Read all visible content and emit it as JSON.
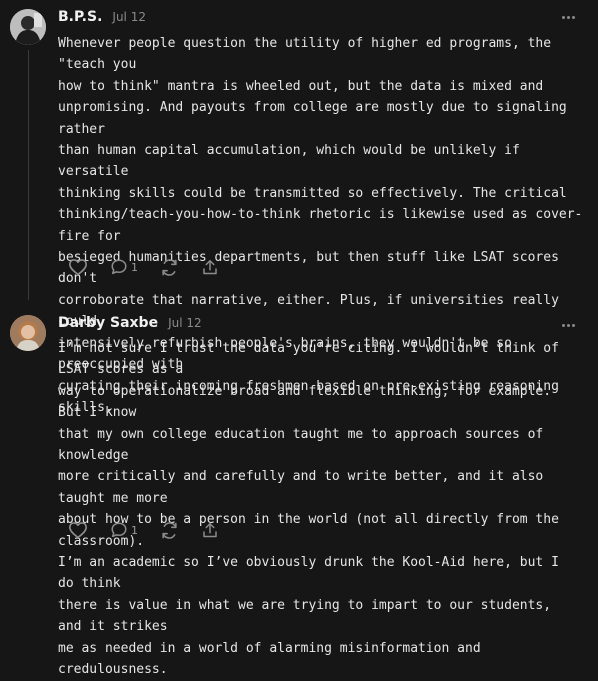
{
  "comments": [
    {
      "author": "B.P.S.",
      "date": "Jul 12",
      "lines": [
        "Whenever people question the utility of higher ed programs, the \"teach you",
        "how to think\" mantra is wheeled out, but the data is mixed and",
        "unpromising. And payouts from college are mostly due to signaling rather",
        "than human capital accumulation, which would be unlikely if versatile",
        "thinking skills could be transmitted so effectively. The critical",
        "thinking/teach-you-how-to-think rhetoric is likewise used as cover-fire for",
        "besieged humanities departments, but then stuff like LSAT scores don't",
        "corroborate that narrative, either. Plus, if universities really could",
        "intensively refurbish people's brains, they wouldn't be so preoccupied with",
        "curating their incoming freshmen based on pre-existing reasoning skills."
      ],
      "reply_count": "1"
    },
    {
      "author": "Darby Saxbe",
      "date": "Jul 12",
      "lines": [
        "I’m not sure I trust the data you’re citing. I wouldn’t think of LSAT scores as a",
        "way to operationalize broad and flexible thinking, for example. But I know",
        "that my own college education taught me to approach sources of knowledge",
        "more critically and carefully and to write better, and it also taught me more",
        "about how to be a person in the world (not all directly from the classroom).",
        "I’m an academic so I’ve obviously drunk the Kool-Aid here, but I do think",
        "there is value in what we are trying to impart to our students, and it strikes",
        "me as needed in a world of alarming misinformation and credulousness."
      ],
      "reply_count": "1"
    }
  ],
  "icons": {
    "like": "heart-icon",
    "reply": "comment-bubble-icon",
    "restack": "restack-icon",
    "share": "share-icon",
    "more": "more-dots-icon"
  },
  "colors": {
    "background": "#161616",
    "text": "#e6e6e6",
    "muted": "#8a8a8a"
  }
}
